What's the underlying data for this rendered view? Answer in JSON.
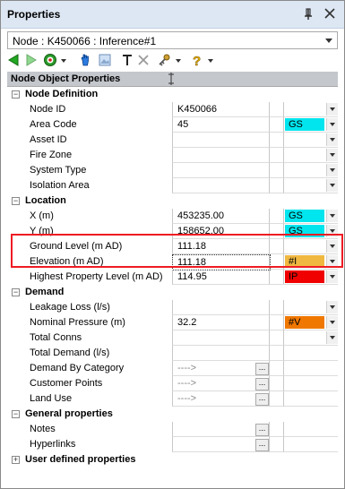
{
  "window": {
    "title": "Properties"
  },
  "selector": {
    "value": "Node : K450066 : Inference#1"
  },
  "toolbar": {
    "icons": [
      "back-arrow-icon",
      "forward-arrow-icon",
      "target-icon",
      "hand-pointer-icon",
      "image-icon",
      "text-tool-icon",
      "delete-x-icon",
      "key-icon",
      "help-question-icon"
    ]
  },
  "grid": {
    "header": "Node Object Properties",
    "categories": [
      {
        "label": "Node Definition",
        "expander": "−"
      },
      {
        "label": "Location",
        "expander": "−"
      },
      {
        "label": "Demand",
        "expander": "−"
      },
      {
        "label": "General properties",
        "expander": "−"
      },
      {
        "label": "User defined properties",
        "expander": "+"
      }
    ],
    "rows": {
      "node_id": {
        "name": "Node ID",
        "value": "K450066"
      },
      "area_code": {
        "name": "Area Code",
        "value": "45",
        "meta": "GS",
        "meta_color": "#00e5ee"
      },
      "asset_id": {
        "name": "Asset ID",
        "value": ""
      },
      "fire_zone": {
        "name": "Fire Zone",
        "value": ""
      },
      "system_type": {
        "name": "System Type",
        "value": ""
      },
      "isolation_area": {
        "name": "Isolation Area",
        "value": ""
      },
      "x": {
        "name": "X (m)",
        "value": "453235.00",
        "meta": "GS",
        "meta_color": "#00e5ee"
      },
      "y": {
        "name": "Y (m)",
        "value": "158652.00",
        "meta": "GS",
        "meta_color": "#00e5ee"
      },
      "ground_level": {
        "name": "Ground Level (m AD)",
        "value": "111.18"
      },
      "elevation": {
        "name": "Elevation (m AD)",
        "value": "111.18",
        "meta": "#I",
        "meta_color": "#f0b840"
      },
      "hpl": {
        "name": "Highest Property Level (m AD)",
        "value": "114.95",
        "meta": "IP",
        "meta_color": "#f00000"
      },
      "leakage": {
        "name": "Leakage Loss (l/s)",
        "value": ""
      },
      "nominal_pressure": {
        "name": "Nominal Pressure (m)",
        "value": "32.2",
        "meta": "#V",
        "meta_color": "#f07800"
      },
      "total_conns": {
        "name": "Total Conns",
        "value": ""
      },
      "total_demand": {
        "name": "Total Demand (l/s)",
        "value": ""
      },
      "demand_by_category": {
        "name": "Demand By Category",
        "value": "---->"
      },
      "customer_points": {
        "name": "Customer Points",
        "value": "---->"
      },
      "land_use": {
        "name": "Land Use",
        "value": "---->"
      },
      "notes": {
        "name": "Notes",
        "value": ""
      },
      "hyperlinks": {
        "name": "Hyperlinks",
        "value": ""
      }
    }
  }
}
